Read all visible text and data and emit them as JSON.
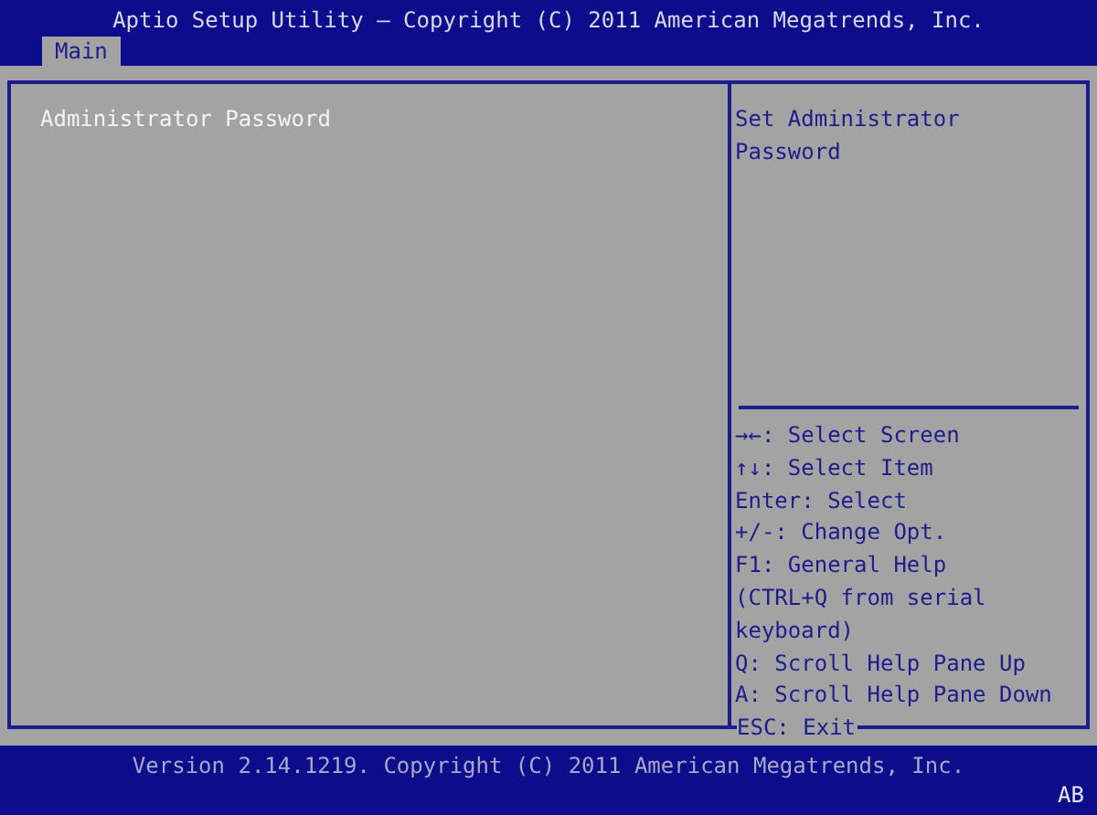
{
  "title": "Aptio Setup Utility – Copyright (C) 2011 American Megatrends, Inc.",
  "tabs": [
    {
      "label": "Main",
      "selected": true
    }
  ],
  "items": [
    {
      "label": "Administrator Password"
    }
  ],
  "help_text": [
    "Set Administrator",
    "Password"
  ],
  "key_help": [
    "→←: Select Screen",
    "↑↓: Select Item",
    "Enter: Select",
    "+/-: Change Opt.",
    "F1: General Help",
    "(CTRL+Q from serial",
    "keyboard)",
    "Q: Scroll Help Pane Up",
    "A: Scroll Help Pane Down",
    "ESC: Exit"
  ],
  "footer": {
    "version": "Version 2.14.1219. Copyright (C) 2011 American Megatrends, Inc.",
    "badge": "AB"
  }
}
